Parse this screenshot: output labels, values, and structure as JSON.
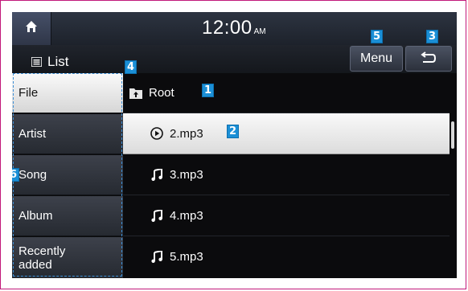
{
  "status_bar": {
    "time": "12:00",
    "ampm": "AM",
    "home_icon": "home-icon"
  },
  "header": {
    "list_label": "List",
    "list_icon": "list-icon",
    "menu_label": "Menu",
    "back_icon": "back-arrow-icon"
  },
  "categories": [
    {
      "label": "File",
      "selected": true
    },
    {
      "label": "Artist",
      "selected": false
    },
    {
      "label": "Song",
      "selected": false
    },
    {
      "label": "Album",
      "selected": false
    },
    {
      "label": "Recently added",
      "selected": false
    }
  ],
  "files": {
    "root": {
      "label": "Root",
      "icon": "folder-up-icon"
    },
    "items": [
      {
        "label": "2.mp3",
        "icon": "play-circle-icon",
        "selected": true
      },
      {
        "label": "3.mp3",
        "icon": "music-note-icon",
        "selected": false
      },
      {
        "label": "4.mp3",
        "icon": "music-note-icon",
        "selected": false
      },
      {
        "label": "5.mp3",
        "icon": "music-note-icon",
        "selected": false
      }
    ]
  },
  "callouts": [
    "1",
    "2",
    "3",
    "4",
    "5",
    "6"
  ],
  "colors": {
    "callout": "#1b8fd6",
    "frame": "#c2187a",
    "selection": "#e8e8e8",
    "screen_bg": "#0b0b0d"
  }
}
